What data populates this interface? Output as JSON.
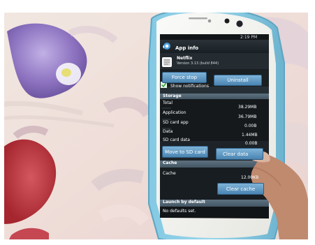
{
  "status_bar": {
    "time": "2:19 PM"
  },
  "app_bar": {
    "title": "App info"
  },
  "app": {
    "name": "Netflix",
    "version": "Version 3.13 (build 844)"
  },
  "buttons": {
    "force_stop": "Force stop",
    "uninstall": "Uninstall",
    "move_to_sd": "Move to SD card",
    "clear_data": "Clear data",
    "clear_cache": "Clear cache"
  },
  "notifications": {
    "label": "Show notifications",
    "checked": true
  },
  "storage": {
    "header": "Storage",
    "rows": [
      {
        "label": "Total",
        "value": "38.29MB"
      },
      {
        "label": "Application",
        "value": "36.79MB"
      },
      {
        "label": "SD card app",
        "value": "0.00B"
      },
      {
        "label": "Data",
        "value": "1.44MB"
      },
      {
        "label": "SD card data",
        "value": "0.00B"
      }
    ]
  },
  "cache": {
    "header": "Cache",
    "label": "Cache",
    "value": "12.00KB"
  },
  "launch": {
    "header": "Launch by default",
    "text": "No defaults set."
  },
  "colors": {
    "accent_blue": "#4a84b1",
    "phone_bezel": "#f7f7f4",
    "phone_case": "#7fc3df",
    "screen_bg": "#121516",
    "section_header": "#4a5d6c",
    "fabric_bg": "#f4e6e2",
    "flower_purple": "#8d73c0",
    "flower_red": "#b8333b"
  }
}
